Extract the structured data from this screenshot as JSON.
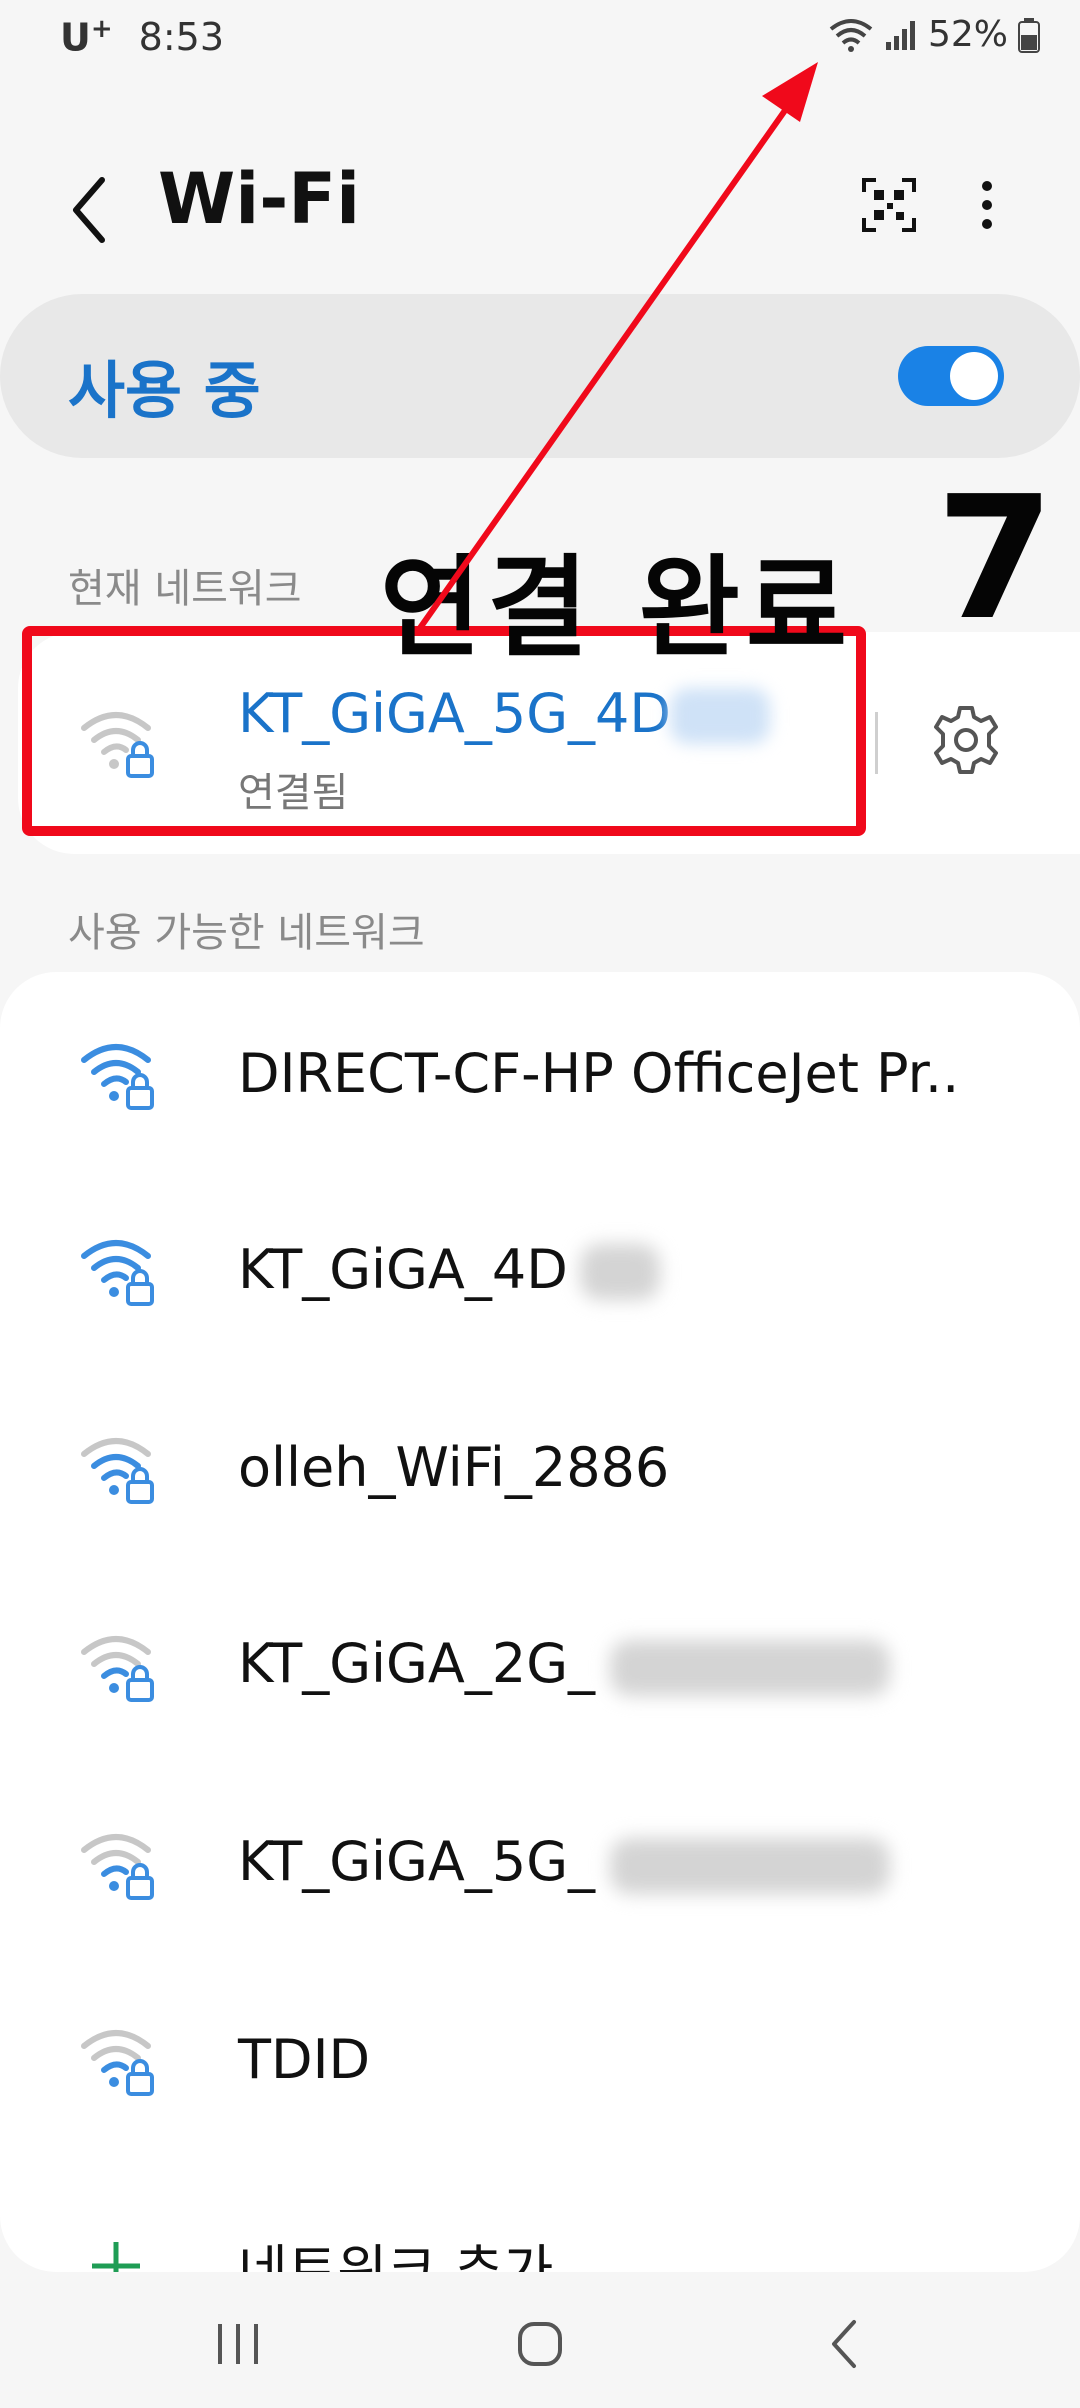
{
  "status_bar": {
    "carrier": "U",
    "carrier_sup": "+",
    "time": "8:53",
    "battery": "52%"
  },
  "header": {
    "title": "Wi-Fi"
  },
  "toggle": {
    "label": "사용 중",
    "state": "on"
  },
  "current_section": {
    "label": "현재 네트워크",
    "network": {
      "name": "KT_GiGA_5G_4D",
      "status": "연결됨"
    }
  },
  "available_section": {
    "label": "사용 가능한 네트워크",
    "networks": [
      {
        "name": "DIRECT-CF-HP OfficeJet Pr..",
        "signal": "strong"
      },
      {
        "name": "KT_GiGA_4D",
        "signal": "strong"
      },
      {
        "name": "olleh_WiFi_2886",
        "signal": "medium"
      },
      {
        "name": "KT_GiGA_2G_",
        "signal": "weak"
      },
      {
        "name": "KT_GiGA_5G_",
        "signal": "weak"
      },
      {
        "name": "TDID",
        "signal": "weak"
      }
    ],
    "add_network": "네트워크 추가"
  },
  "annotation": {
    "text": "연결 완료",
    "number": "7"
  },
  "colors": {
    "accent": "#1a73c9",
    "highlight": "#f0091b",
    "wifi_strong": "#3b8de0",
    "wifi_weak": "#c7c7c7"
  }
}
